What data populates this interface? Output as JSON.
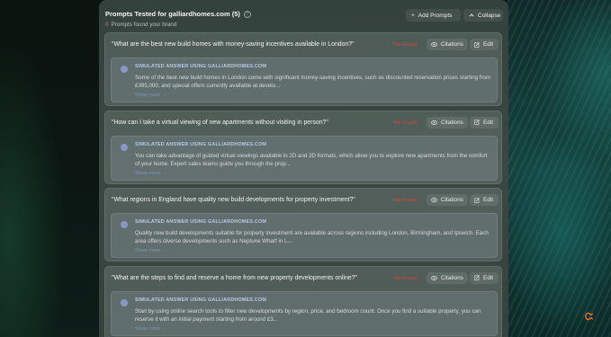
{
  "header": {
    "title": "Prompts Tested for galliardhomes.com (5)",
    "found_count": "0",
    "found_text": "Prompts found your brand",
    "add_label": "Add Prompts",
    "collapse_label": "Collapse"
  },
  "cards": [
    {
      "question": "\"What are the best new build homes with money-saving incentives available in London?\"",
      "status": "Not Found",
      "citations_label": "Citations",
      "edit_label": "Edit",
      "answer_label": "SIMULATED ANSWER USING GALLIARDHOMES.COM",
      "answer_text": "Some of the best new build homes in London come with significant money-saving incentives, such as discounted reservation prices starting from £395,000, and special offers currently available at develo...",
      "show_more": "Show more →"
    },
    {
      "question": "\"How can I take a virtual viewing of new apartments without visiting in person?\"",
      "status": "Not Found",
      "citations_label": "Citations",
      "edit_label": "Edit",
      "answer_label": "SIMULATED ANSWER USING GALLIARDHOMES.COM",
      "answer_text": "You can take advantage of guided virtual viewings available in 2D and 3D formats, which allow you to explore new apartments from the comfort of your home. Expert sales teams guide you through the prop...",
      "show_more": "Show more →"
    },
    {
      "question": "\"What regions in England have quality new build developments for property investment?\"",
      "status": "Not Found",
      "citations_label": "Citations",
      "edit_label": "Edit",
      "answer_label": "SIMULATED ANSWER USING GALLIARDHOMES.COM",
      "answer_text": "Quality new build developments suitable for property investment are available across regions including London, Birmingham, and Ipswich. Each area offers diverse developments such as Neptune Wharf in L...",
      "show_more": "Show more →"
    },
    {
      "question": "\"What are the steps to find and reserve a home from new property developments online?\"",
      "status": "Not Found",
      "citations_label": "Citations",
      "edit_label": "Edit",
      "answer_label": "SIMULATED ANSWER USING GALLIARDHOMES.COM",
      "answer_text": "Start by using online search tools to filter new developments by region, price, and bedroom count. Once you find a suitable property, you can reserve it with an initial payment starting from around £3...",
      "show_more": "Show more →"
    }
  ],
  "brand_mark": "Ꮸ",
  "colors": {
    "accent_orange": "#e8702a",
    "not_found_red": "#d8463a",
    "label_blue": "#b9c8e8"
  }
}
